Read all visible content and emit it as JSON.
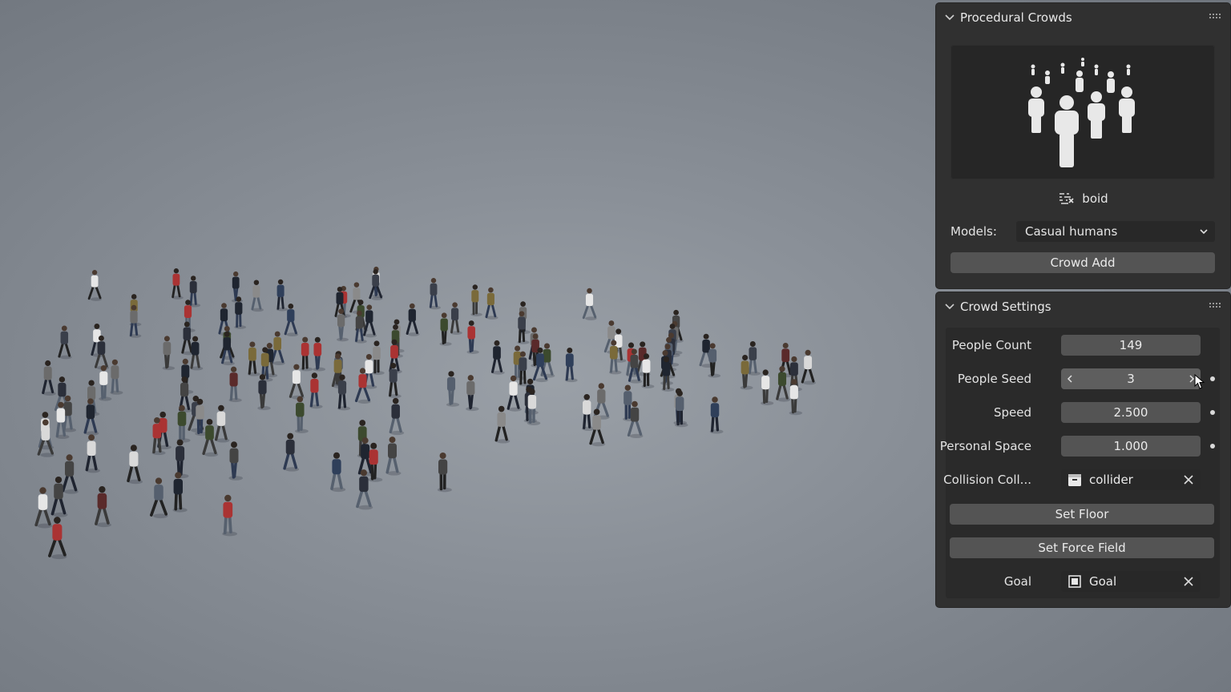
{
  "panels": {
    "procedural_crowds": {
      "title": "Procedural Crowds",
      "preview_icon": "crowd-people-icon",
      "boid_label": "boid",
      "models_label": "Models:",
      "models_value": "Casual humans",
      "crowd_add_label": "Crowd Add"
    },
    "crowd_settings": {
      "title": "Crowd Settings",
      "people_count_label": "People Count",
      "people_count_value": "149",
      "people_seed_label": "People Seed",
      "people_seed_value": "3",
      "speed_label": "Speed",
      "speed_value": "2.500",
      "personal_space_label": "Personal Space",
      "personal_space_value": "1.000",
      "collision_label": "Collision Coll...",
      "collision_value": "collider",
      "set_floor_label": "Set Floor",
      "set_force_field_label": "Set Force Field",
      "goal_label": "Goal",
      "goal_value": "Goal"
    }
  },
  "colors": {
    "panel_bg": "#303030",
    "field_bg": "#545454",
    "viewport_bg": "#868c94"
  }
}
